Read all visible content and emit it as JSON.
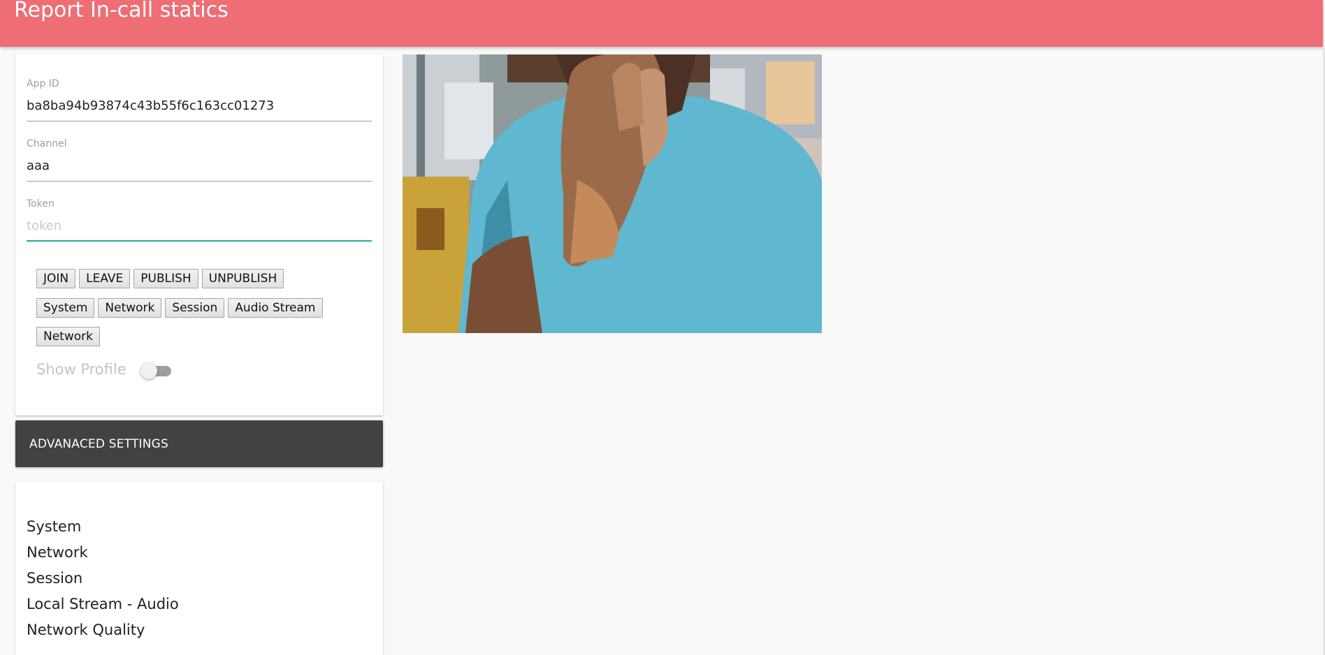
{
  "header": {
    "title": "Report In-call statics"
  },
  "form": {
    "app_id": {
      "label": "App ID",
      "value": "ba8ba94b93874c43b55f6c163cc01273"
    },
    "channel": {
      "label": "Channel",
      "value": "aaa"
    },
    "token": {
      "label": "Token",
      "value": "",
      "placeholder": "token"
    }
  },
  "buttons": {
    "row1": [
      "JOIN",
      "LEAVE",
      "PUBLISH",
      "UNPUBLISH"
    ],
    "row2": [
      "System",
      "Network",
      "Session",
      "Audio Stream"
    ],
    "row3": [
      "Network"
    ]
  },
  "profile": {
    "label": "Show Profile",
    "enabled": false
  },
  "advanced": {
    "title": "ADVANACED SETTINGS"
  },
  "stats": {
    "items": [
      "System",
      "Network",
      "Session",
      "Local Stream - Audio",
      "Network Quality"
    ]
  },
  "colors": {
    "header": "#ef6d74",
    "accent_underline": "#26a69a",
    "advanced_bar": "#424242",
    "background": "#f9f9f9"
  },
  "icons": {
    "video": "local-video-feed"
  }
}
